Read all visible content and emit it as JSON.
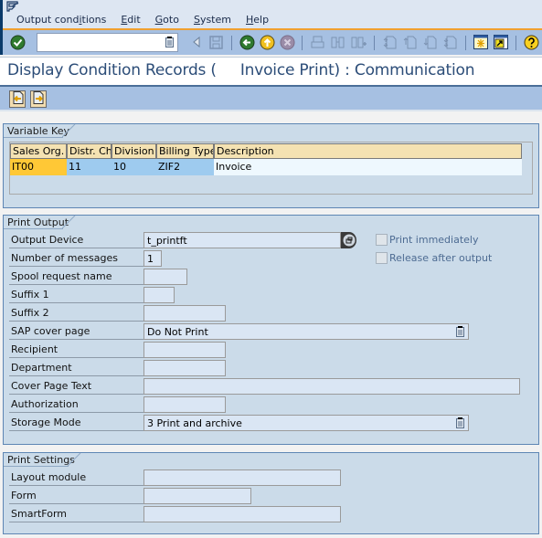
{
  "menu": {
    "items": [
      {
        "label": "Output conditions"
      },
      {
        "label": "Edit"
      },
      {
        "label": "Goto"
      },
      {
        "label": "System"
      },
      {
        "label": "Help"
      }
    ]
  },
  "system_toolbar": {
    "command_field": {
      "value": "",
      "placeholder": ""
    },
    "icons": [
      "enter-icon",
      "back-nav-icon",
      "save-icon",
      "back-icon",
      "exit-icon",
      "cancel-icon",
      "print-icon",
      "find-icon",
      "find-next-icon",
      "first-page-icon",
      "previous-page-icon",
      "next-page-icon",
      "last-page-icon",
      "create-session-icon",
      "shortcut-icon",
      "help-icon"
    ]
  },
  "title": "Display Condition Records (     Invoice Print) : Communication",
  "app_toolbar": {
    "icons": [
      "previous-record-icon",
      "next-record-icon"
    ]
  },
  "variable_key": {
    "title": "Variable Key",
    "columns": [
      "Sales Org.",
      "Distr. Chl",
      "Division",
      "Billing Type",
      "Description"
    ],
    "rows": [
      [
        "IT00",
        "11",
        "10",
        "ZIF2",
        "Invoice"
      ]
    ]
  },
  "print_output": {
    "title": "Print Output",
    "fields": [
      {
        "label": "Output Device",
        "value": "t_printft"
      },
      {
        "label": "Number of messages",
        "value": "1"
      },
      {
        "label": "Spool request name",
        "value": ""
      },
      {
        "label": "Suffix 1",
        "value": ""
      },
      {
        "label": "Suffix 2",
        "value": ""
      },
      {
        "label": "SAP cover page",
        "value": "Do Not Print"
      },
      {
        "label": "Recipient",
        "value": ""
      },
      {
        "label": "Department",
        "value": ""
      },
      {
        "label": "Cover Page Text",
        "value": ""
      },
      {
        "label": "Authorization",
        "value": ""
      },
      {
        "label": "Storage Mode",
        "value": "3 Print and archive"
      }
    ],
    "checkboxes": [
      {
        "label": "Print immediately",
        "checked": false
      },
      {
        "label": "Release after output",
        "checked": false
      }
    ]
  },
  "print_settings": {
    "title": "Print Settings",
    "fields": [
      {
        "label": "Layout module",
        "value": ""
      },
      {
        "label": "Form",
        "value": ""
      },
      {
        "label": "SmartForm",
        "value": ""
      }
    ]
  },
  "colors": {
    "accent_orange": "#f0a030",
    "toolbar_blue": "#a6c0e2",
    "group_bg": "#cbdbe9",
    "title_text": "#2c4d78",
    "key_highlight": "#ffc836",
    "row_blue": "#9ecbef",
    "header_tan": "#f4e2b2"
  }
}
